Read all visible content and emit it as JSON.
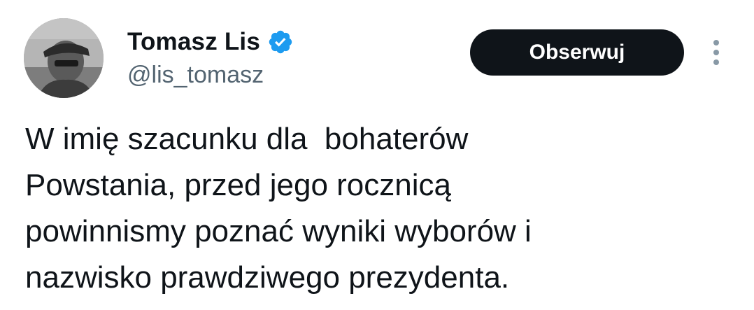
{
  "author": {
    "display_name": "Tomasz Lis",
    "handle": "@lis_tomasz",
    "verified": true,
    "avatar_icon": "profile-photo"
  },
  "actions": {
    "follow_label": "Obserwuj",
    "more_icon": "more-vertical-icon"
  },
  "tweet": {
    "text": "W imię szacunku dla  bohaterów\nPowstania, przed jego rocznicą\npowinnismy poznać wyniki wyborów i\nnazwisko prawdziwego prezydenta."
  },
  "colors": {
    "text_primary": "#0f1419",
    "text_secondary": "#536471",
    "verified_blue": "#1d9bf0",
    "button_bg": "#0f1419",
    "button_text": "#ffffff",
    "more_icon": "#8899a6"
  }
}
